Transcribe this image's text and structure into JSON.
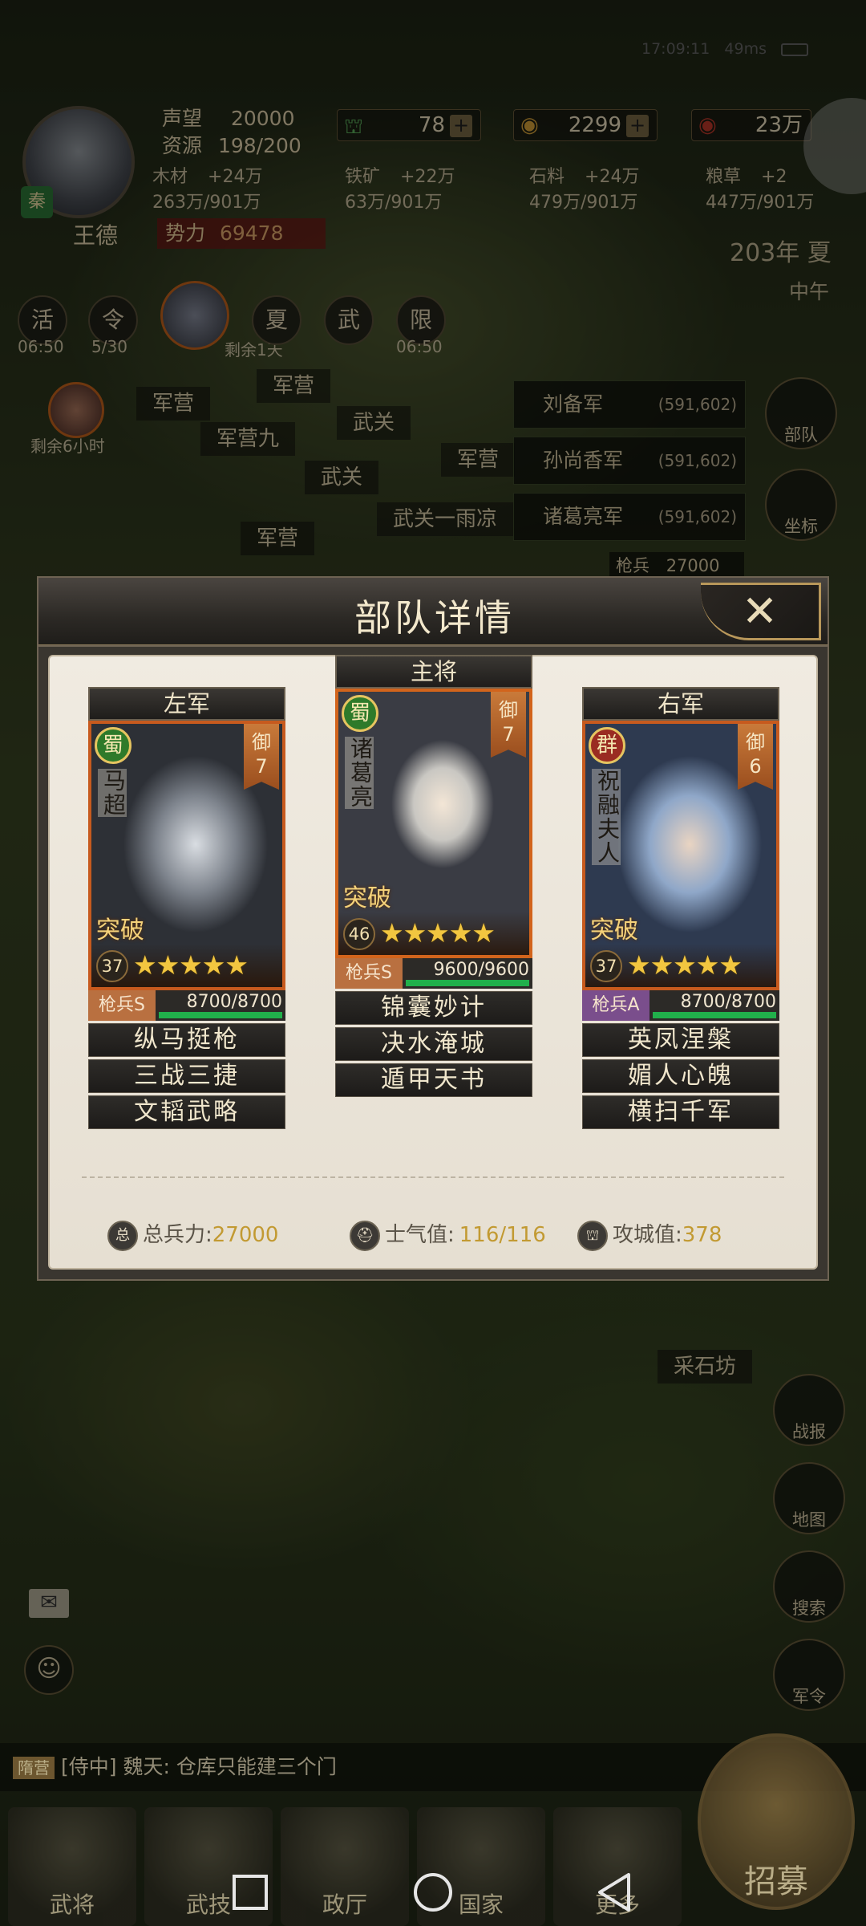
{
  "status_bar": {
    "time": "17:09:11",
    "ping": "49ms"
  },
  "player": {
    "name": "王德",
    "nation": "秦",
    "prestige_label": "声望",
    "prestige": "20000",
    "resource_label": "资源",
    "resource": "198/200",
    "power_label": "势力",
    "power": "69478"
  },
  "currency": {
    "troops": "78",
    "copper": "2299",
    "gold": "23万"
  },
  "resources": [
    {
      "name": "木材",
      "rate": "+24万",
      "stock": "263万/901万"
    },
    {
      "name": "铁矿",
      "rate": "+22万",
      "stock": "63万/901万"
    },
    {
      "name": "石料",
      "rate": "+24万",
      "stock": "479万/901万"
    },
    {
      "name": "粮草",
      "rate": "+2",
      "stock": "447万/901万"
    }
  ],
  "season": {
    "year": "203年 夏",
    "time_of_day": "中午"
  },
  "events": [
    {
      "icon": "活",
      "time": "06:50"
    },
    {
      "icon": "令",
      "time": "5/30"
    },
    {
      "icon": "夏",
      "time": ""
    },
    {
      "icon": "武",
      "time": ""
    },
    {
      "icon": "限",
      "time": "06:50"
    }
  ],
  "event_note": "剩余1天",
  "hero_note": "剩余6小时",
  "map_labels": [
    "军营",
    "军营",
    "武关",
    "军营九",
    "军营",
    "武关",
    "武关一雨凉",
    "军营"
  ],
  "armies": [
    {
      "name": "刘备军",
      "coord": "(591,602)"
    },
    {
      "name": "孙尚香军",
      "coord": "(591,602)"
    },
    {
      "name": "诸葛亮军",
      "coord": "(591,602)"
    }
  ],
  "army_troop_row": {
    "label": "枪兵",
    "value": "27000"
  },
  "side_buttons": [
    "部队",
    "坐标"
  ],
  "right_tools": [
    "战报",
    "地图",
    "搜索",
    "军令"
  ],
  "place_label": "采石坊",
  "modal": {
    "title": "部队详情",
    "close_symbol": "✕",
    "cards": [
      {
        "slot": "左军",
        "faction": "蜀",
        "name": "马超",
        "cost_label": "御",
        "cost": "7",
        "breakthrough": "突破",
        "level": "37",
        "stars": "★★★★★",
        "troop_type": "枪兵S",
        "troops": "8700/8700",
        "troop_fill": 1.0,
        "skills": [
          "纵马挺枪",
          "三战三捷",
          "文韬武略"
        ]
      },
      {
        "slot": "主将",
        "faction": "蜀",
        "name": "诸葛亮",
        "cost_label": "御",
        "cost": "7",
        "breakthrough": "突破",
        "level": "46",
        "stars": "★★★★★",
        "troop_type": "枪兵S",
        "troops": "9600/9600",
        "troop_fill": 1.0,
        "skills": [
          "锦囊妙计",
          "决水淹城",
          "遁甲天书"
        ]
      },
      {
        "slot": "右军",
        "faction": "群",
        "name": "祝融夫人",
        "cost_label": "御",
        "cost": "6",
        "breakthrough": "突破",
        "level": "37",
        "stars": "★★★★★",
        "troop_type": "枪兵A",
        "troops": "8700/8700",
        "troop_fill": 1.0,
        "skills": [
          "英凤涅槃",
          "媚人心魄",
          "横扫千军"
        ]
      }
    ],
    "stats": {
      "total_label": "总兵力:",
      "total_icon": "总",
      "total": "27000",
      "morale_label": "士气值:",
      "morale": "116/116",
      "siege_label": "攻城值:",
      "siege": "378"
    }
  },
  "chat": {
    "channel": "隋营",
    "message": "[侍中] 魏天: 仓库只能建三个门"
  },
  "bottom_nav": [
    "武将",
    "武技",
    "政厅",
    "国家",
    "更多"
  ],
  "recruit_label": "招募",
  "colors": {
    "panel": "#ebe5d9",
    "accent_gold": "#c29a32",
    "troop_bar": "#21b04b",
    "card_border": "#c75a1e"
  }
}
